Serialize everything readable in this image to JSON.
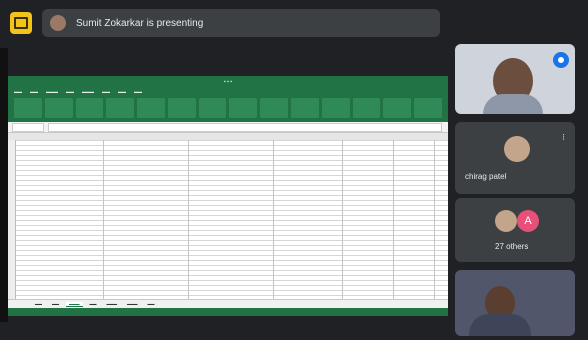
{
  "presenter": {
    "banner_text": "Sumit Zokarkar is presenting"
  },
  "participants": [
    {
      "name": "chirag patel"
    },
    {
      "name": "27 others",
      "avatar_letter": "A"
    }
  ],
  "colors": {
    "accent": "#1a73e8",
    "excel_green": "#217346",
    "present_yellow": "#f2c318"
  },
  "icons": [
    "present-screen-icon",
    "mic-active-icon",
    "more-icon"
  ]
}
